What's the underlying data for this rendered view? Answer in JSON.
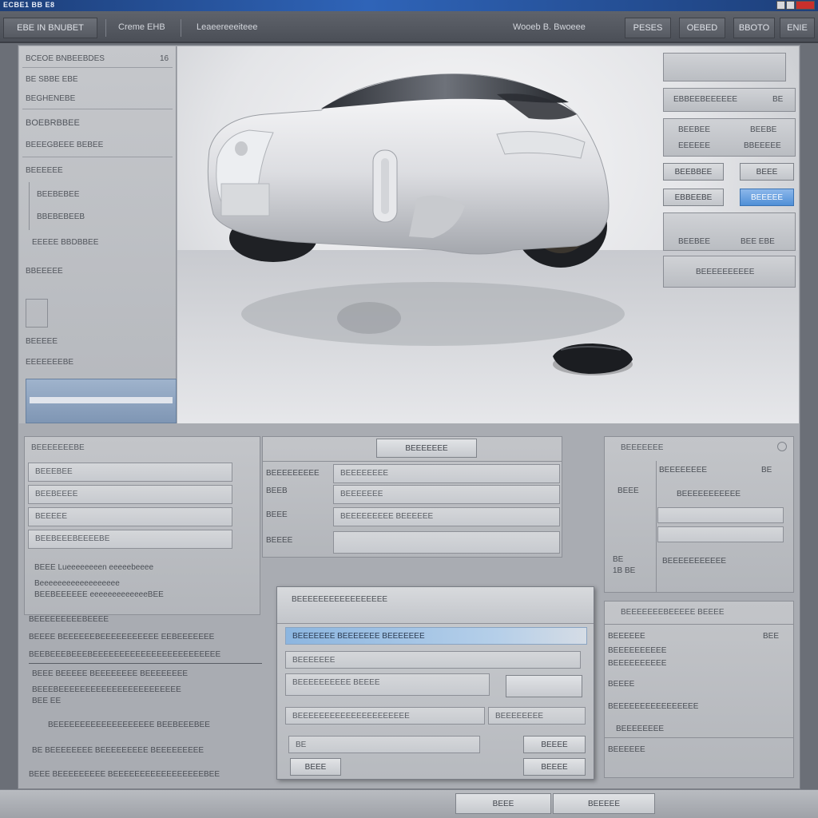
{
  "window": {
    "title": "ECBE1 BB E8"
  },
  "toolbar": {
    "menu_label": "EBE IN BNUBET",
    "tab_label": "Creme EHB",
    "path_label": "Leaeereeeiteee",
    "center_label": "Wooeb B. Bwoeee",
    "right_buttons": [
      "PESES",
      "OEBED",
      "BBOTO",
      "ENIE"
    ]
  },
  "left_panel": {
    "header": "BCEOE  BNBEEBDES",
    "header_value": "16",
    "rows": [
      "BE SBBE EBE",
      "BEGHENEBE",
      "BOEBRBBEE",
      "BEEEGBEEE  BEBEE",
      "BEEEEEE",
      "BEEBEBEE",
      "BBEBEBEEB",
      "EEEEE BBDBBEE",
      "BBEEEEE",
      "BEEEEE",
      "EEEEEEEBE"
    ]
  },
  "right_panel": {
    "item1": "EBBEEBEEEEEE",
    "item1_value": "BE",
    "item2a": "BEEBEE",
    "item2b": "BEEBE",
    "item2c": "EEEEEE",
    "item2d": "BBEEEEE",
    "btn_a": "BEEBBEE",
    "btn_b": "BEEE",
    "btn_c": "EBBEEBE",
    "btn_active": "BEEEEE",
    "item3a": "BEEBEE",
    "item3b": "BEE EBE",
    "item4": "BEEEEEEEEEE"
  },
  "lower_left": {
    "header": "BEEEEEEEBE",
    "fields": [
      "BEEEBEE",
      "BEEBEEEE",
      "BEEEEE",
      "BEEBEEEBEEEEBE"
    ],
    "note1": "BEEE Lueeeeeeeen eeeeebeeee",
    "note2": "Beeeeeeeeeeeeeeeeee",
    "note3": "BEEBEEEEEE eeeeeeeeeeeeeBEE",
    "sub_header": "BEEEEEEEEEBEEEE",
    "line1": "BEEEE BEEEEEEBEEEEEEEEEEE EEBEEEEEEE",
    "line2": "BEEBEEEBEEEBEEEEEEEEEEEEEEEEEEEEEEEE",
    "line3": "BEEE BEEEEE BEEEEEEEE BEEEEEEEE",
    "line4": "BEEEBEEEEEEEEEEEEEEEEEEEEEEE",
    "line5": "BEE EE",
    "line6": "BEEEEEEEEEEEEEEEEEEE BEEBEEEBEE",
    "line7": "BE BEEEEEEEE  BEEEEEEEEE  BEEEEEEEEE",
    "line8": "BEEE BEEEEEEEEE BEEEEEEEEEEEEEEEEEBEE"
  },
  "lower_center": {
    "tab_button": "BEEEEEEE",
    "labels": [
      "BEEEEEEEEE",
      "BEEB",
      "BEEE",
      "BEEEE"
    ],
    "values": [
      "BEEEEEEEE",
      "BEEEEEEE",
      "BEEEEEEEEE BEEEEEE",
      ""
    ]
  },
  "dialog": {
    "title": "BEEEEEEEEEEEEEEEEE",
    "highlight": "BEEEEEEE BEEEEEEE  BEEEEEEE",
    "row2": "BEEEEEEE",
    "row3": "BEEEEEEEEEE BEEEE",
    "dropdown": "BEEEEEEEEEEEEEEEEEEEEE",
    "dropdown2": "BEEEEEEEE",
    "field_small": "BE",
    "btn_right1": "BEEEE",
    "btn_left": "BEEE",
    "btn_right2": "BEEEE"
  },
  "lower_right": {
    "header": "BEEEEEEE",
    "label1": "BEEEEEEEE",
    "label1_value": "BE",
    "side_a": "BEEE",
    "side_b": "BE",
    "side_c": "1B BE",
    "row1": "BEEEEEEEEEEE",
    "row2": "BEEEEEEEEEEE",
    "sub_header": "BEEEEEEEBEEEEE  BEEEE",
    "list": [
      "BEEEEEE",
      "BEEEEEEEEEE",
      "BEEEEEEEEEE",
      "BEEEE",
      "BEEEEEEEEEEEEEEEE",
      "BEEEEEEEE",
      "BEEEEEE"
    ],
    "list_value": "BEE"
  },
  "statusbar": {
    "btn1": "BEEE",
    "btn2": "BEEEEE"
  }
}
